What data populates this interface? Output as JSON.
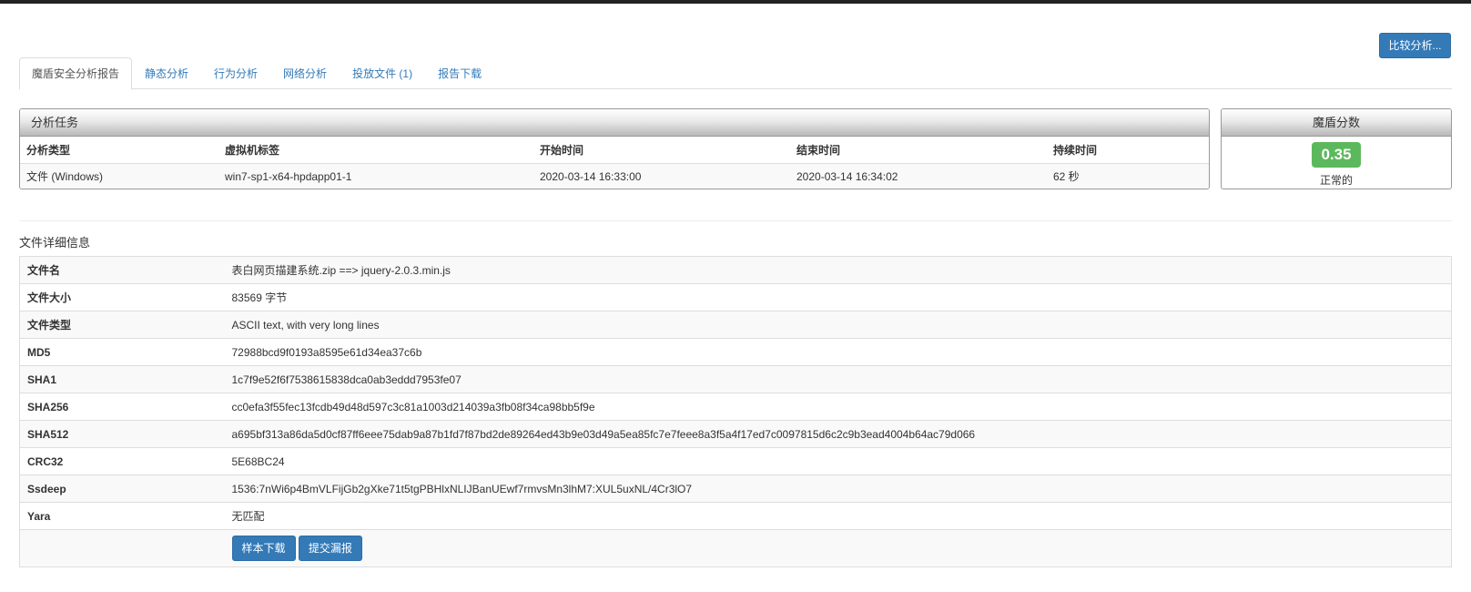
{
  "header": {
    "compare_button": "比较分析..."
  },
  "tabs": [
    {
      "label": "魔盾安全分析报告",
      "active": true
    },
    {
      "label": "静态分析"
    },
    {
      "label": "行为分析"
    },
    {
      "label": "网络分析"
    },
    {
      "label": "投放文件 (1)"
    },
    {
      "label": "报告下载"
    }
  ],
  "task": {
    "title": "分析任务",
    "columns": [
      "分析类型",
      "虚拟机标签",
      "开始时间",
      "结束时间",
      "持续时间"
    ],
    "row": [
      "文件 (Windows)",
      "win7-sp1-x64-hpdapp01-1",
      "2020-03-14 16:33:00",
      "2020-03-14 16:34:02",
      "62 秒"
    ]
  },
  "score": {
    "title": "魔盾分数",
    "value": "0.35",
    "label": "正常的",
    "badge_color": "#5cb85c"
  },
  "file_details": {
    "title": "文件详细信息",
    "rows": [
      {
        "key": "文件名",
        "value": "表白网页描建系统.zip ==> jquery-2.0.3.min.js"
      },
      {
        "key": "文件大小",
        "value": "83569 字节"
      },
      {
        "key": "文件类型",
        "value": "ASCII text, with very long lines"
      },
      {
        "key": "MD5",
        "value": "72988bcd9f0193a8595e61d34ea37c6b"
      },
      {
        "key": "SHA1",
        "value": "1c7f9e52f6f7538615838dca0ab3eddd7953fe07"
      },
      {
        "key": "SHA256",
        "value": "cc0efa3f55fec13fcdb49d48d597c3c81a1003d214039a3fb08f34ca98bb5f9e"
      },
      {
        "key": "SHA512",
        "value": "a695bf313a86da5d0cf87ff6eee75dab9a87b1fd7f87bd2de89264ed43b9e03d49a5ea85fc7e7feee8a3f5a4f17ed7c0097815d6c2c9b3ead4004b64ac79d066"
      },
      {
        "key": "CRC32",
        "value": "5E68BC24"
      },
      {
        "key": "Ssdeep",
        "value": "1536:7nWi6p4BmVLFijGb2gXke71t5tgPBHlxNLIJBanUEwf7rmvsMn3lhM7:XUL5uxNL/4Cr3lO7"
      },
      {
        "key": "Yara",
        "value": "无匹配"
      }
    ],
    "download_button": "样本下载",
    "report_button": "提交漏报"
  },
  "accent_color": "#337ab7"
}
